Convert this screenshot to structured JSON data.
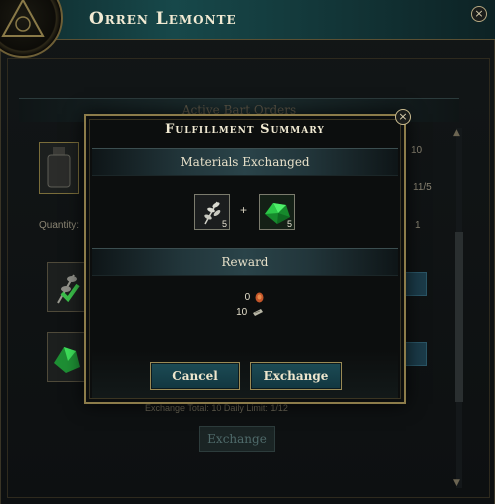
{
  "window": {
    "title": "Orren Lemonte",
    "close_glyph": "×",
    "section_title": "Active Bart Orders",
    "quantity_label": "Quantity:",
    "right_values": [
      "10",
      "11/5",
      "1"
    ],
    "footer_text": "Exchange Total: 10  Daily Limit: 1/12",
    "exchange_label": "Exchange"
  },
  "dialog": {
    "title": "Fulfillment Summary",
    "close_glyph": "×",
    "materials_header": "Materials Exchanged",
    "materials": [
      {
        "icon": "herb-icon",
        "count": "5"
      },
      {
        "icon": "green-crystal-icon",
        "count": "5"
      }
    ],
    "plus": "+",
    "reward_header": "Reward",
    "rewards": [
      {
        "amount": "0",
        "icon": "amber-coin-icon"
      },
      {
        "amount": "10",
        "icon": "ticket-icon"
      }
    ],
    "cancel_label": "Cancel",
    "exchange_label": "Exchange"
  },
  "colors": {
    "accent_teal": "#1c4b55",
    "gold_border": "#8c7c4a",
    "crystal_green": "#2fd04a"
  }
}
